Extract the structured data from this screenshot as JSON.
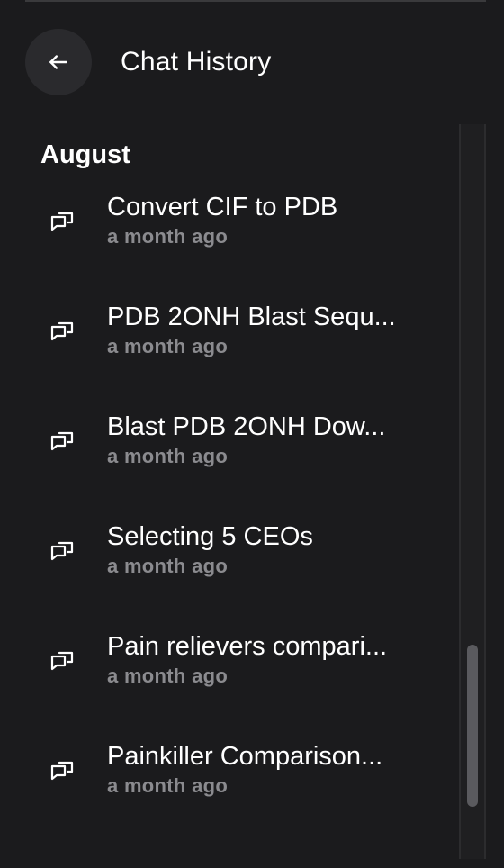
{
  "header": {
    "title": "Chat History",
    "back_icon": "arrow-left-icon"
  },
  "history": {
    "section_label": "August",
    "item_icon": "chat-bubbles-icon",
    "items": [
      {
        "title": "Convert CIF to PDB",
        "time": "a month ago"
      },
      {
        "title": "PDB 2ONH Blast Sequ...",
        "time": "a month ago"
      },
      {
        "title": "Blast PDB 2ONH Dow...",
        "time": "a month ago"
      },
      {
        "title": "Selecting 5 CEOs",
        "time": "a month ago"
      },
      {
        "title": "Pain relievers compari...",
        "time": "a month ago"
      },
      {
        "title": "Painkiller Comparison...",
        "time": "a month ago"
      }
    ]
  },
  "colors": {
    "background": "#1b1b1d",
    "button_bg": "#2a2a2d",
    "muted_text": "#8b8b8f",
    "scroll_thumb": "#5a5a5e"
  }
}
